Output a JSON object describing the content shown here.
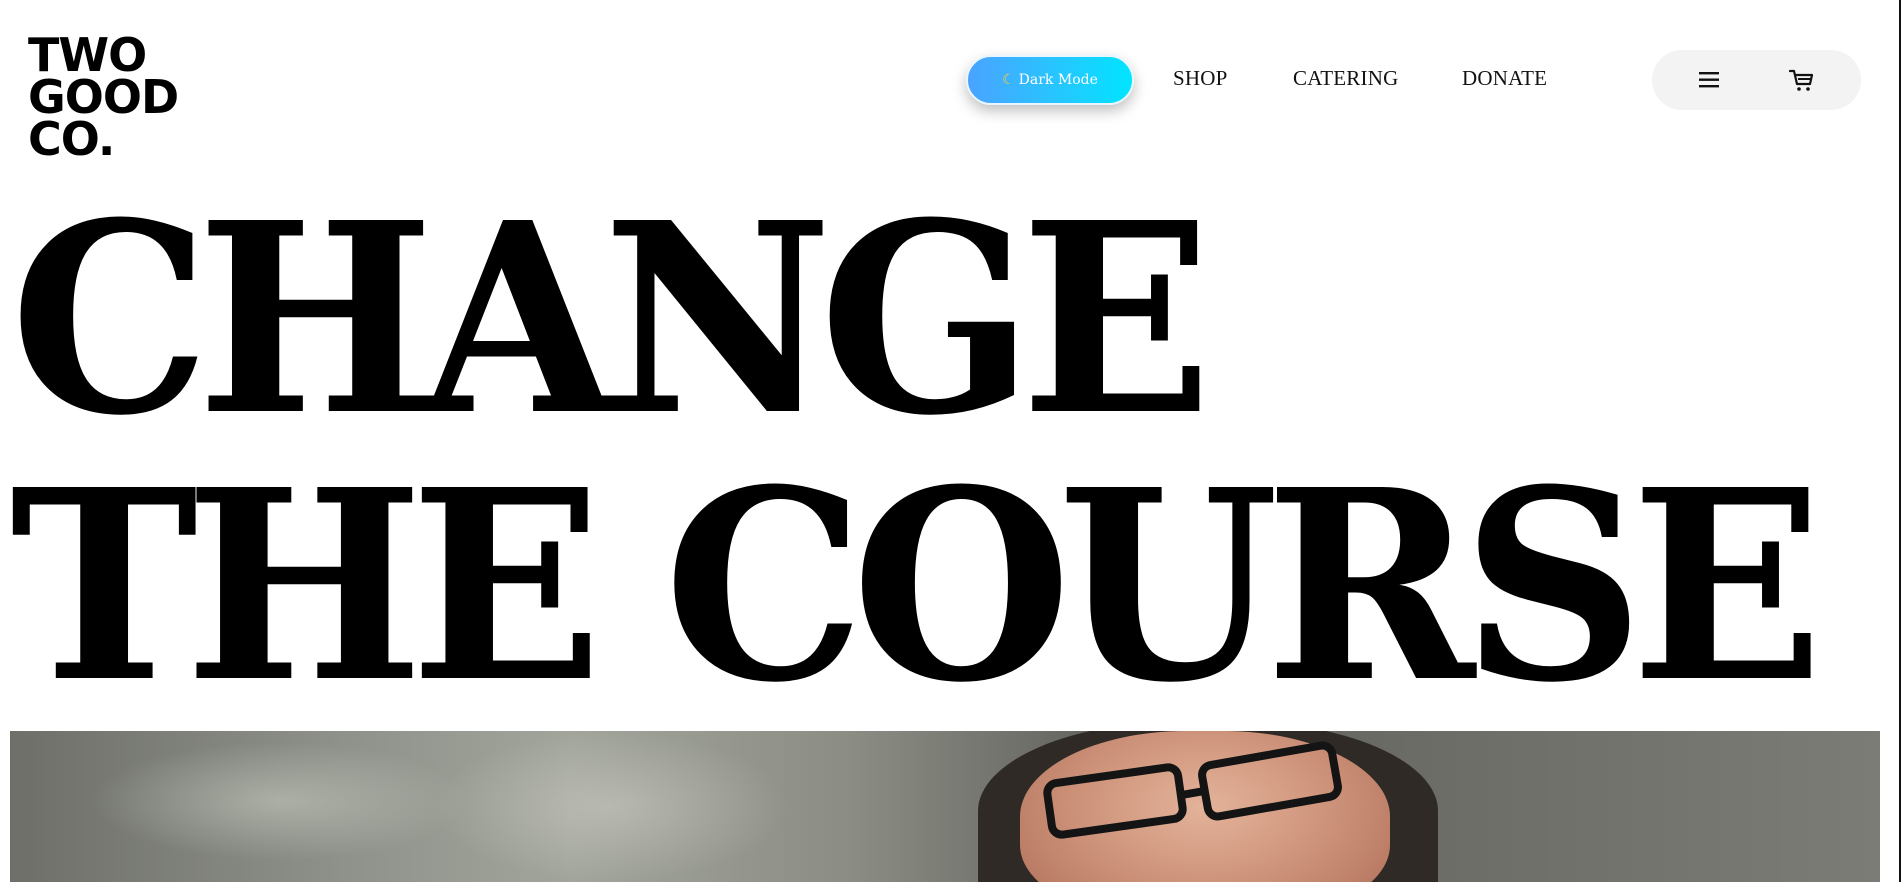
{
  "logo": {
    "line1": "TWO",
    "line2": "GOOD",
    "line3": "CO."
  },
  "header": {
    "dark_mode_label": "Dark Mode",
    "nav": {
      "shop": "SHOP",
      "catering": "CATERING",
      "donate": "DONATE"
    },
    "icons": {
      "menu": "hamburger-menu-icon",
      "cart": "shopping-cart-icon",
      "moon": "moon-icon"
    }
  },
  "hero": {
    "headline_line1": "CHANGE",
    "headline_line2": "THE COURSE"
  },
  "colors": {
    "toggle_gradient_start": "#4aa3ff",
    "toggle_gradient_end": "#00e5ff",
    "pill_background": "#f3f3f3",
    "text": "#000000"
  }
}
